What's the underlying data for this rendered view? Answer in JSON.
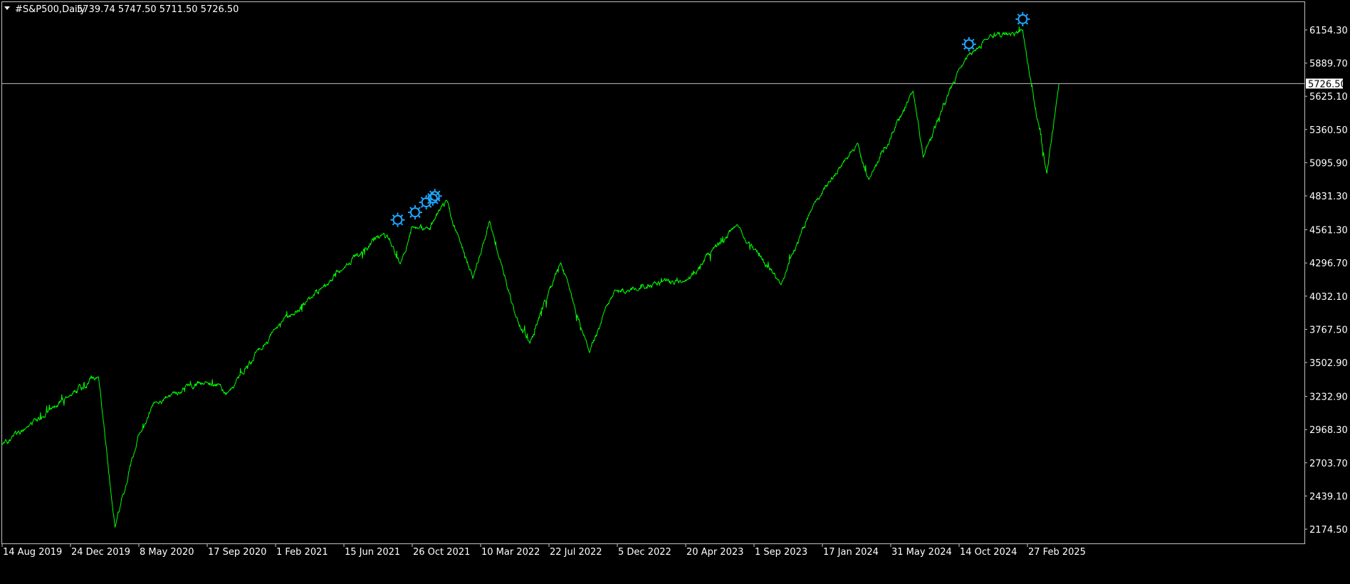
{
  "window": {
    "symbol_title": "#S&P500,Daily",
    "ohlc": "5739.74 5747.50 5711.50 5726.50",
    "menu_arrow_icon": "triangle-down-icon"
  },
  "colors": {
    "background": "#000000",
    "frame": "#c0c0c0",
    "price_line": "#00ff00",
    "marker": "#1ea7ff",
    "text": "#ffffff",
    "current_price_bg": "#ffffff",
    "current_price_text": "#000000"
  },
  "chart_data": {
    "type": "line",
    "title": "#S&P500,Daily",
    "series": [
      {
        "name": "",
        "x": [
          "14 Aug 2019",
          "30 Sep 2019",
          "24 Dec 2019",
          "19 Feb 2020",
          "23 Mar 2020",
          "8 May 2020",
          "10 Jun 2020",
          "17 Sep 2020",
          "30 Oct 2020",
          "1 Feb 2021",
          "15 Jun 2021",
          "2 Sep 2021",
          "4 Oct 2021",
          "26 Oct 2021",
          "30 Nov 2021",
          "3 Jan 2022",
          "24 Feb 2022",
          "29 Mar 2022",
          "20 May 2022",
          "16 Jun 2022",
          "16 Aug 2022",
          "12 Oct 2022",
          "1 Dec 2022",
          "20 Apr 2023",
          "31 Jul 2023",
          "27 Oct 2023",
          "1 Jan 2024",
          "28 Mar 2024",
          "19 Apr 2024",
          "16 Jul 2024",
          "5 Aug 2024",
          "14 Oct 2024",
          "6 Dec 2024",
          "19 Feb 2025",
          "8 Apr 2025",
          "2 May 2025"
        ],
        "y": [
          2850,
          2980,
          3240,
          3390,
          2190,
          2930,
          3190,
          3350,
          3270,
          3770,
          4250,
          4540,
          4290,
          4580,
          4560,
          4790,
          4170,
          4630,
          3860,
          3660,
          4300,
          3580,
          4080,
          4150,
          4600,
          4120,
          4770,
          5250,
          4960,
          5670,
          5140,
          5830,
          6080,
          6150,
          5010,
          5727
        ]
      }
    ],
    "markers": [
      {
        "x": "29 Sep 2021",
        "y": 4640
      },
      {
        "x": "2 Nov 2021",
        "y": 4700
      },
      {
        "x": "24 Nov 2021",
        "y": 4780
      },
      {
        "x": "7 Dec 2021",
        "y": 4810
      },
      {
        "x": "11 Dec 2021",
        "y": 4830
      },
      {
        "x": "4 Nov 2024",
        "y": 6040
      },
      {
        "x": "19 Feb 2025",
        "y": 6240
      }
    ],
    "current_price": 5726.5,
    "x_tick_labels": [
      "14 Aug 2019",
      "24 Dec 2019",
      "8 May 2020",
      "17 Sep 2020",
      "1 Feb 2021",
      "15 Jun 2021",
      "26 Oct 2021",
      "10 Mar 2022",
      "22 Jul 2022",
      "5 Dec 2022",
      "20 Apr 2023",
      "1 Sep 2023",
      "17 Jan 2024",
      "31 May 2024",
      "14 Oct 2024",
      "27 Feb 2025"
    ],
    "y_tick_labels": [
      "6154.30",
      "5889.70",
      "5625.10",
      "5360.50",
      "5095.90",
      "4831.30",
      "4561.30",
      "4296.70",
      "4032.10",
      "3767.50",
      "3502.90",
      "3232.90",
      "2968.30",
      "2703.70",
      "2439.10",
      "2174.50"
    ],
    "y_ticks": [
      6154.3,
      5889.7,
      5625.1,
      5360.5,
      5095.9,
      4831.3,
      4561.3,
      4296.7,
      4032.1,
      3767.5,
      3502.9,
      3232.9,
      2968.3,
      2703.7,
      2439.1,
      2174.5
    ],
    "ylim": [
      2085,
      6325
    ],
    "xlabel": "",
    "ylabel": "",
    "grid": false,
    "legend": "none"
  }
}
